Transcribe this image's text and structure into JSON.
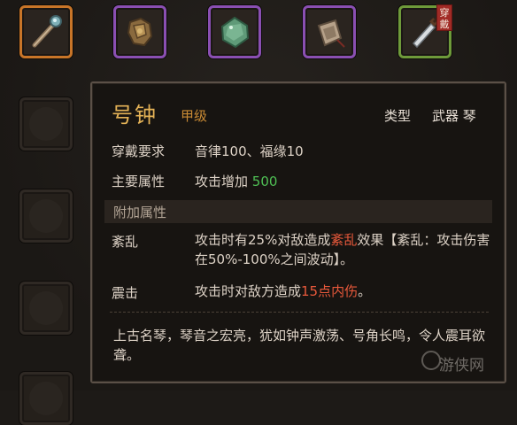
{
  "inventory": {
    "top_slots": [
      {
        "name": "staff-item",
        "rarity_color": "#c87528"
      },
      {
        "name": "armor-item",
        "rarity_color": "#8a4fb2"
      },
      {
        "name": "jade-item",
        "rarity_color": "#8a4fb2"
      },
      {
        "name": "pouch-item",
        "rarity_color": "#8a4fb2"
      },
      {
        "name": "blade-item",
        "rarity_color": "#6e9a3a",
        "tag": "穿戴"
      }
    ]
  },
  "tooltip": {
    "item_name": "号钟",
    "grade": "甲级",
    "type_label": "类型",
    "type_value": "武器 琴",
    "requirement_label": "穿戴要求",
    "requirement_value": "音律100、福缘10",
    "main_attr_label": "主要属性",
    "main_attr_text": "攻击增加",
    "main_attr_value": "500",
    "extra_attr_header": "附加属性",
    "effects": [
      {
        "label": "紊乱",
        "text_1": "攻击时有25%对敌造成",
        "highlight": "紊乱",
        "text_2": "效果【紊乱：攻击伤害在50%-100%之间波动】。"
      },
      {
        "label": "震击",
        "text_1": "攻击时对敌方造成",
        "highlight": "15点内伤",
        "text_2": "。"
      }
    ],
    "flavor_text": "上古名琴，琴音之宏亮，犹如钟声激荡、号角长鸣，令人震耳欲聋。"
  },
  "watermark": "游侠网",
  "colors": {
    "gold": "#e5b357",
    "grade": "#c88a34",
    "green_value": "#4fbf54",
    "red_highlight": "#e9593b"
  }
}
